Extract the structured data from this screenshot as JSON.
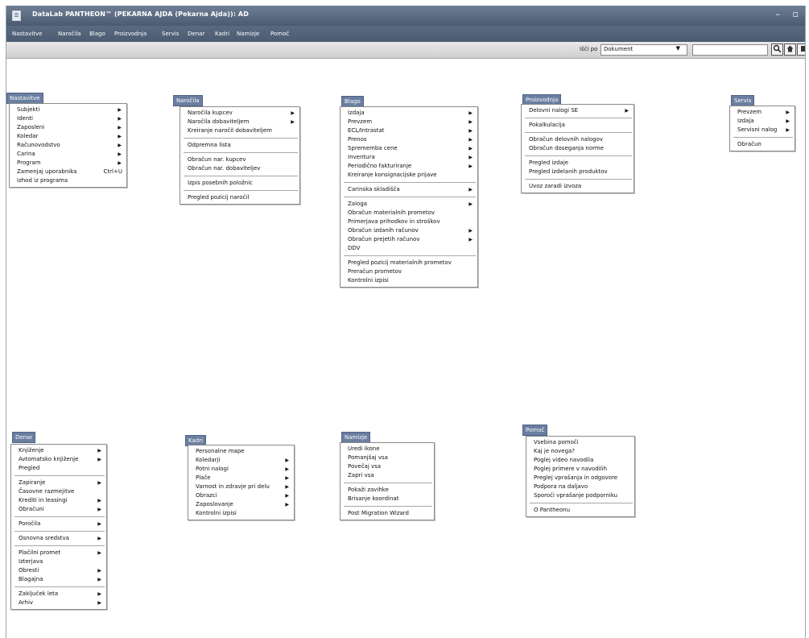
{
  "window": {
    "title": "DataLab PANTHEON™ (PEKARNA AJDA (Pekarna Ajda)): AD",
    "controls": [
      "–",
      "▫"
    ]
  },
  "menubar": [
    "Nastavitve",
    "Naročila",
    "Blago",
    "Proizvodnja",
    "Servis",
    "Denar",
    "Kadri",
    "Namizje",
    "Pomoč"
  ],
  "toolbar": {
    "search_label": "Išči po",
    "search_select": "Dokument",
    "search_placeholder": "",
    "buttons": [
      "search-icon",
      "home-icon",
      "next-icon"
    ]
  },
  "menus": [
    {
      "title": "Nastavitve",
      "groups": [
        [
          {
            "label": "Subjekti",
            "sub": true
          },
          {
            "label": "Identi",
            "sub": true
          },
          {
            "label": "Zaposleni",
            "sub": true
          },
          {
            "label": "Koledar",
            "sub": true
          },
          {
            "label": "Računovodstvo",
            "sub": true
          },
          {
            "label": "Carina",
            "sub": true
          },
          {
            "label": "Program",
            "sub": true
          },
          {
            "label": "Zamenjaj uporabnika",
            "shortcut": "Ctrl+U"
          },
          {
            "label": "Izhod iz programa"
          }
        ]
      ]
    },
    {
      "title": "Naročila",
      "groups": [
        [
          {
            "label": "Naročila kupcev",
            "sub": true
          },
          {
            "label": "Naročila dobaviteljem",
            "sub": true
          },
          {
            "label": "Kreiranje naročil dobaviteljem"
          }
        ],
        [
          {
            "label": "Odpremna lista"
          }
        ],
        [
          {
            "label": "Obračun nar. kupcev"
          },
          {
            "label": "Obračun nar. dobaviteljev"
          }
        ],
        [
          {
            "label": "Izpis posebnih položnic"
          }
        ],
        [
          {
            "label": "Pregled pozicij naročil"
          }
        ]
      ]
    },
    {
      "title": "Blago",
      "groups": [
        [
          {
            "label": "Izdaja",
            "sub": true
          },
          {
            "label": "Prevzem",
            "sub": true
          },
          {
            "label": "ECL/Intrastat",
            "sub": true
          },
          {
            "label": "Prenos",
            "sub": true
          },
          {
            "label": "Sprememba cene",
            "sub": true
          },
          {
            "label": "Inventura",
            "sub": true
          },
          {
            "label": "Periodično fakturiranje",
            "sub": true
          },
          {
            "label": "Kreiranje konsignacijske prijave"
          }
        ],
        [
          {
            "label": "Carinska skladišča",
            "sub": true
          }
        ],
        [
          {
            "label": "Zaloga",
            "sub": true
          },
          {
            "label": "Obračun materialnih prometov"
          },
          {
            "label": "Primerjava prihodkov in stroškov"
          },
          {
            "label": "Obračun izdanih računov",
            "sub": true
          },
          {
            "label": "Obračun prejetih računov",
            "sub": true
          },
          {
            "label": "DDV"
          }
        ],
        [
          {
            "label": "Pregled pozicij materialnih prometov"
          },
          {
            "label": "Preračun prometov"
          },
          {
            "label": "Kontrolni izpisi"
          }
        ]
      ]
    },
    {
      "title": "Proizvodnja",
      "groups": [
        [
          {
            "label": "Delovni nalogi SE",
            "sub": true
          }
        ],
        [
          {
            "label": "Pokalkulacija"
          }
        ],
        [
          {
            "label": "Obračun delovnih nalogov"
          },
          {
            "label": "Obračun doseganja norme"
          }
        ],
        [
          {
            "label": "Pregled izdaje"
          },
          {
            "label": "Pregled izdelanih produktov"
          }
        ],
        [
          {
            "label": "Uvoz zaradi izvoza"
          }
        ]
      ]
    },
    {
      "title": "Servis",
      "groups": [
        [
          {
            "label": "Prevzem",
            "sub": true
          },
          {
            "label": "Izdaja",
            "sub": true
          },
          {
            "label": "Servisni nalog",
            "sub": true
          }
        ],
        [
          {
            "label": "Obračun"
          }
        ]
      ]
    },
    {
      "title": "Denar",
      "groups": [
        [
          {
            "label": "Knjiženje",
            "sub": true
          },
          {
            "label": "Avtomatsko knjiženje",
            "sub": true
          },
          {
            "label": "Pregled"
          }
        ],
        [
          {
            "label": "Zapiranje",
            "sub": true
          },
          {
            "label": "Časovne razmejitve"
          },
          {
            "label": "Krediti in leasingi",
            "sub": true
          },
          {
            "label": "Obračuni",
            "sub": true
          }
        ],
        [
          {
            "label": "Poročila",
            "sub": true
          }
        ],
        [
          {
            "label": "Osnovna sredstva",
            "sub": true
          }
        ],
        [
          {
            "label": "Plačilni promet",
            "sub": true
          },
          {
            "label": "Izterjava"
          },
          {
            "label": "Obresti",
            "sub": true
          },
          {
            "label": "Blagajna",
            "sub": true
          }
        ],
        [
          {
            "label": "Zaključek leta",
            "sub": true
          },
          {
            "label": "Arhiv",
            "sub": true
          }
        ]
      ]
    },
    {
      "title": "Kadri",
      "groups": [
        [
          {
            "label": "Personalne mape"
          },
          {
            "label": "Koledarji",
            "sub": true
          },
          {
            "label": "Potni nalogi",
            "sub": true
          },
          {
            "label": "Plače",
            "sub": true
          },
          {
            "label": "Varnost in zdravje pri delu",
            "sub": true
          },
          {
            "label": "Obrazci",
            "sub": true
          },
          {
            "label": "Zaposlovanje",
            "sub": true
          },
          {
            "label": "Kontrolni izpisi"
          }
        ]
      ]
    },
    {
      "title": "Namizje",
      "groups": [
        [
          {
            "label": "Uredi ikone"
          },
          {
            "label": "Pomanjšaj vsa"
          },
          {
            "label": "Povečaj vsa"
          },
          {
            "label": "Zapri vsa"
          }
        ],
        [
          {
            "label": "Pokaži zavihke"
          },
          {
            "label": "Brisanje koordinat"
          }
        ],
        [
          {
            "label": "Post Migration Wizard"
          }
        ]
      ]
    },
    {
      "title": "Pomoč",
      "groups": [
        [
          {
            "label": "Vsebina pomoči"
          },
          {
            "label": "Kaj je novega?"
          },
          {
            "label": "Poglej video navodila"
          },
          {
            "label": "Poglej primere v navodilih"
          },
          {
            "label": "Preglej vprašanja in odgovore"
          },
          {
            "label": "Podpora na daljavo"
          },
          {
            "label": "Sporoči vprašanje podporniku"
          }
        ],
        [
          {
            "label": "O Pantheonu"
          }
        ]
      ]
    }
  ]
}
